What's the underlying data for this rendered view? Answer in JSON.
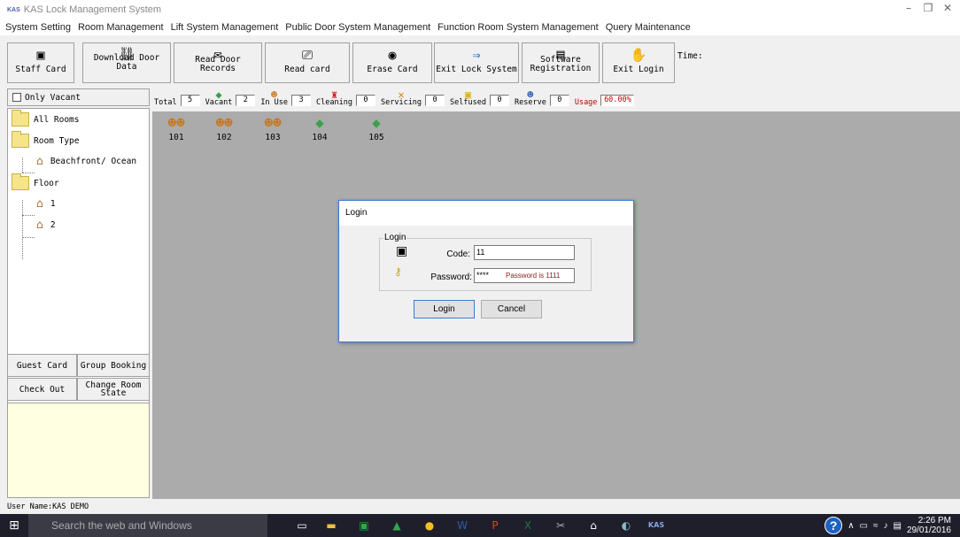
{
  "app": {
    "logo": "KAS",
    "title": "KAS Lock Management System"
  },
  "menu": [
    "System Setting",
    "Room Management",
    "Lift System Management",
    "Public Door System Management",
    "Function Room System Management",
    "Query Maintenance"
  ],
  "toolbar": {
    "buttons": [
      {
        "line1": "",
        "line2": "Staff Card",
        "icon": "staff-card-icon"
      },
      {
        "line1": "Download Door",
        "line2": "Data",
        "icon": "download-door-icon"
      },
      {
        "line1": "Read Door",
        "line2": "Records",
        "icon": "read-records-icon"
      },
      {
        "line1": "",
        "line2": "Read card",
        "icon": "read-card-icon"
      },
      {
        "line1": "",
        "line2": "Erase Card",
        "icon": "erase-card-icon"
      },
      {
        "line1": "",
        "line2": "Exit Lock System",
        "icon": "exit-arrow-icon"
      },
      {
        "line1": "Software",
        "line2": "Registration",
        "icon": "registration-icon"
      },
      {
        "line1": "",
        "line2": "Exit Login",
        "icon": "exit-login-icon"
      }
    ],
    "time_label": "Time:"
  },
  "status": {
    "total_label": "Total",
    "total": "5",
    "vacant_label": "Vacant",
    "vacant": "2",
    "inuse_label": "In Use",
    "inuse": "3",
    "cleaning_label": "Cleaning",
    "cleaning": "0",
    "servicing_label": "Servicing",
    "servicing": "0",
    "selfused_label": "Selfused",
    "selfused": "0",
    "reserve_label": "Reserve",
    "reserve": "0",
    "usage_label": "Usage",
    "usage": "60.00%"
  },
  "left": {
    "only_vacant": "Only Vacant",
    "tree": {
      "all_rooms": "All Rooms",
      "room_type": "Room Type",
      "room_type_child": "Beachfront/ Ocean",
      "floor": "Floor",
      "floor_1": "1",
      "floor_2": "2"
    },
    "buttons": {
      "guest_card": "Guest Card",
      "group_booking": "Group Booking",
      "check_out": "Check Out",
      "change_room_l1": "Change Room",
      "change_room_l2": "State"
    }
  },
  "rooms": [
    {
      "number": "101",
      "state": "in-use"
    },
    {
      "number": "102",
      "state": "in-use"
    },
    {
      "number": "103",
      "state": "in-use"
    },
    {
      "number": "104",
      "state": "vacant"
    },
    {
      "number": "105",
      "state": "vacant"
    }
  ],
  "user_bar": "User Name:KAS DEMO",
  "dialog": {
    "title": "Login",
    "group_label": "Login",
    "code_label": "Code:",
    "code_value": "11",
    "password_label": "Password:",
    "password_value": "****",
    "password_hint": "Password is 1111",
    "login_button": "Login",
    "cancel_button": "Cancel"
  },
  "taskbar": {
    "search_placeholder": "Search the web and Windows",
    "time": "2:26 PM",
    "date": "29/01/2016",
    "kas_app": "KAS"
  }
}
